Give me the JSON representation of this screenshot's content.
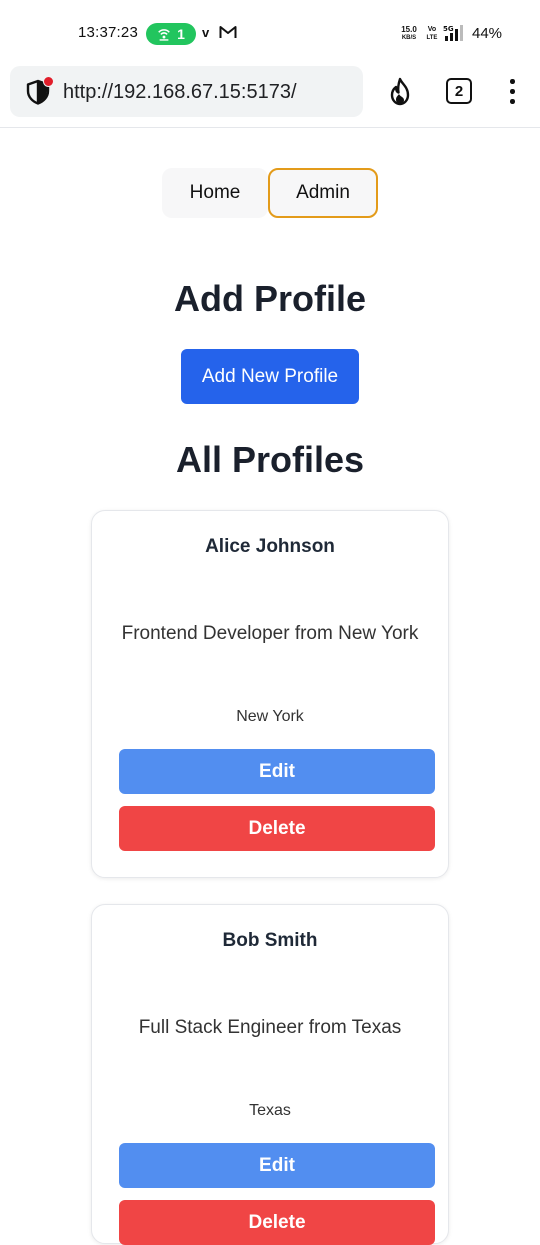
{
  "status_bar": {
    "time": "13:37:23",
    "hotspot_count": "1",
    "carrier_v": "v",
    "net_speed_value": "15.0",
    "net_speed_unit": "KB/S",
    "volte_top": "Vo",
    "volte_bottom": "LTE",
    "network": "5G",
    "battery": "44%"
  },
  "browser": {
    "url": "http://192.168.67.15:5173/",
    "tab_count": "2",
    "icons": [
      "shield-icon",
      "fire-icon",
      "tabs-icon",
      "more-vert-icon"
    ]
  },
  "nav": {
    "home": "Home",
    "admin": "Admin"
  },
  "add_section": {
    "title": "Add Profile",
    "button": "Add New Profile"
  },
  "profiles_section": {
    "title": "All Profiles",
    "profiles": [
      {
        "name": "Alice Johnson",
        "description": "Frontend Developer from New York",
        "location": "New York",
        "edit": "Edit",
        "delete": "Delete"
      },
      {
        "name": "Bob Smith",
        "description": "Full Stack Engineer from Texas",
        "location": "Texas",
        "edit": "Edit",
        "delete": "Delete"
      }
    ]
  },
  "colors": {
    "primary_button": "#2563eb",
    "edit_button": "#528ef0",
    "delete_button": "#f04545",
    "active_nav_border": "#e39b1a",
    "hotspot_pill": "#22c55e"
  }
}
